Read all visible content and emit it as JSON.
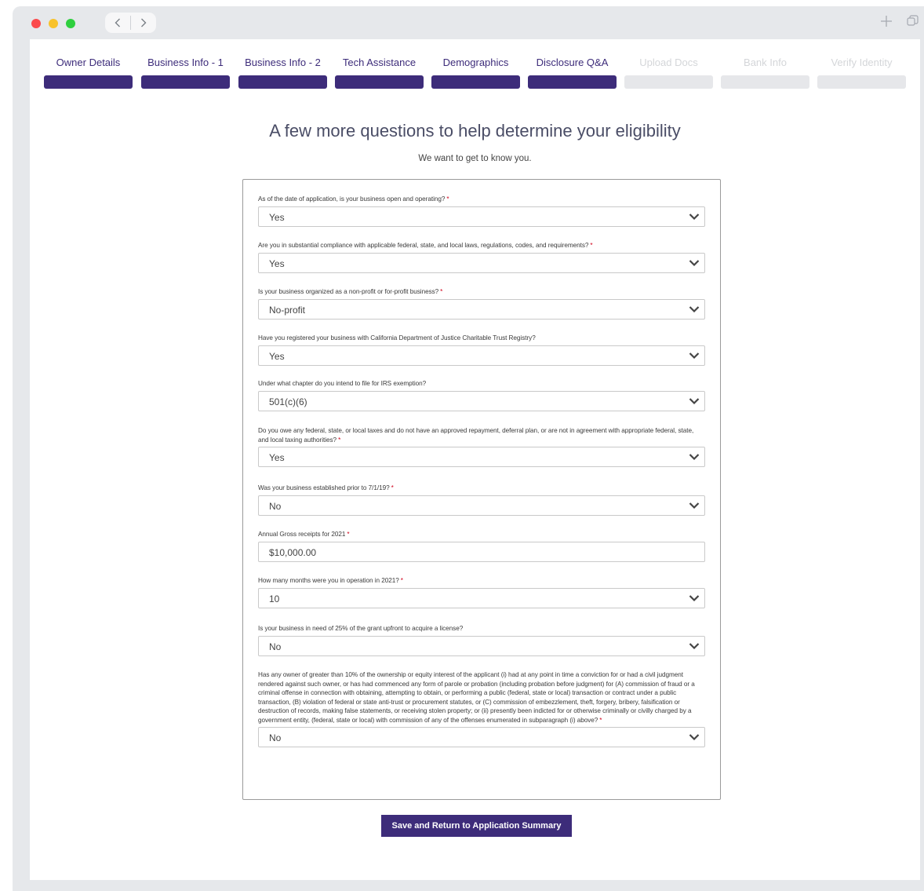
{
  "steps": [
    {
      "label": "Owner Details",
      "state": "complete"
    },
    {
      "label": "Business Info - 1",
      "state": "complete"
    },
    {
      "label": "Business Info - 2",
      "state": "complete"
    },
    {
      "label": "Tech Assistance",
      "state": "complete"
    },
    {
      "label": "Demographics",
      "state": "complete"
    },
    {
      "label": "Disclosure Q&A",
      "state": "current"
    },
    {
      "label": "Upload Docs",
      "state": "disabled"
    },
    {
      "label": "Bank Info",
      "state": "disabled"
    },
    {
      "label": "Verify Identity",
      "state": "disabled"
    }
  ],
  "page": {
    "title": "A few more questions to help determine your eligibility",
    "subtitle": "We want to get to know you."
  },
  "questions": [
    {
      "label": "As of the date of application, is your business open and operating?",
      "required": "*",
      "value": "Yes",
      "type": "select"
    },
    {
      "label": "Are you in substantial compliance with applicable federal, state, and local laws, regulations, codes, and requirements?",
      "required": "*",
      "value": "Yes",
      "type": "select"
    },
    {
      "label": "Is your business organized as a non-profit or for-profit business?",
      "required": "*",
      "value": "No-profit",
      "type": "select"
    },
    {
      "label": "Have you registered your business with California Department of Justice Charitable Trust Registry?",
      "required": "",
      "value": "Yes",
      "type": "select"
    },
    {
      "label": "Under what chapter do you intend to file for IRS exemption?",
      "required": "",
      "value": "501(c)(6)",
      "type": "select"
    },
    {
      "label": "Do you owe any federal, state, or local taxes and do not have an approved repayment, deferral plan, or are not in agreement with appropriate federal, state, and local taxing authorities?",
      "required": "*",
      "value": "Yes",
      "type": "select"
    },
    {
      "label": "Was your business established prior to 7/1/19?",
      "required": "*",
      "value": "No",
      "type": "select"
    },
    {
      "label": "Annual Gross receipts for 2021",
      "required": "*",
      "value": "$10,000.00",
      "type": "text"
    },
    {
      "label": "How many months were you in operation in 2021?",
      "required": "*",
      "value": "10",
      "type": "select"
    },
    {
      "label": "Is your business in need of 25% of the grant upfront to acquire a license?",
      "required": "",
      "value": "No",
      "type": "select"
    },
    {
      "label": "Has any owner of greater than 10% of the ownership or equity interest of the applicant (i) had at any point in time a conviction for or had a civil judgment rendered against such owner, or has had commenced any form of parole or probation (including probation before judgment) for (A) commission of fraud or a criminal offense in connection with obtaining, attempting to obtain, or performing a public (federal, state or local) transaction or contract under a public transaction, (B) violation of federal or state anti-trust or procurement statutes, or (C) commission of embezzlement, theft, forgery, bribery, falsification or destruction of records, making false statements, or receiving stolen property; or (ii) presently been indicted for or otherwise criminally or civilly charged by a government entity, (federal, state or local) with commission of any of the offenses enumerated in subparagraph (i) above?",
      "required": "*",
      "value": "No",
      "type": "select"
    }
  ],
  "actions": {
    "save_label": "Save and Return to Application Summary"
  },
  "colors": {
    "primary": "#3d2c7a",
    "disabled": "#e6e7ea",
    "required": "#d0021b"
  }
}
